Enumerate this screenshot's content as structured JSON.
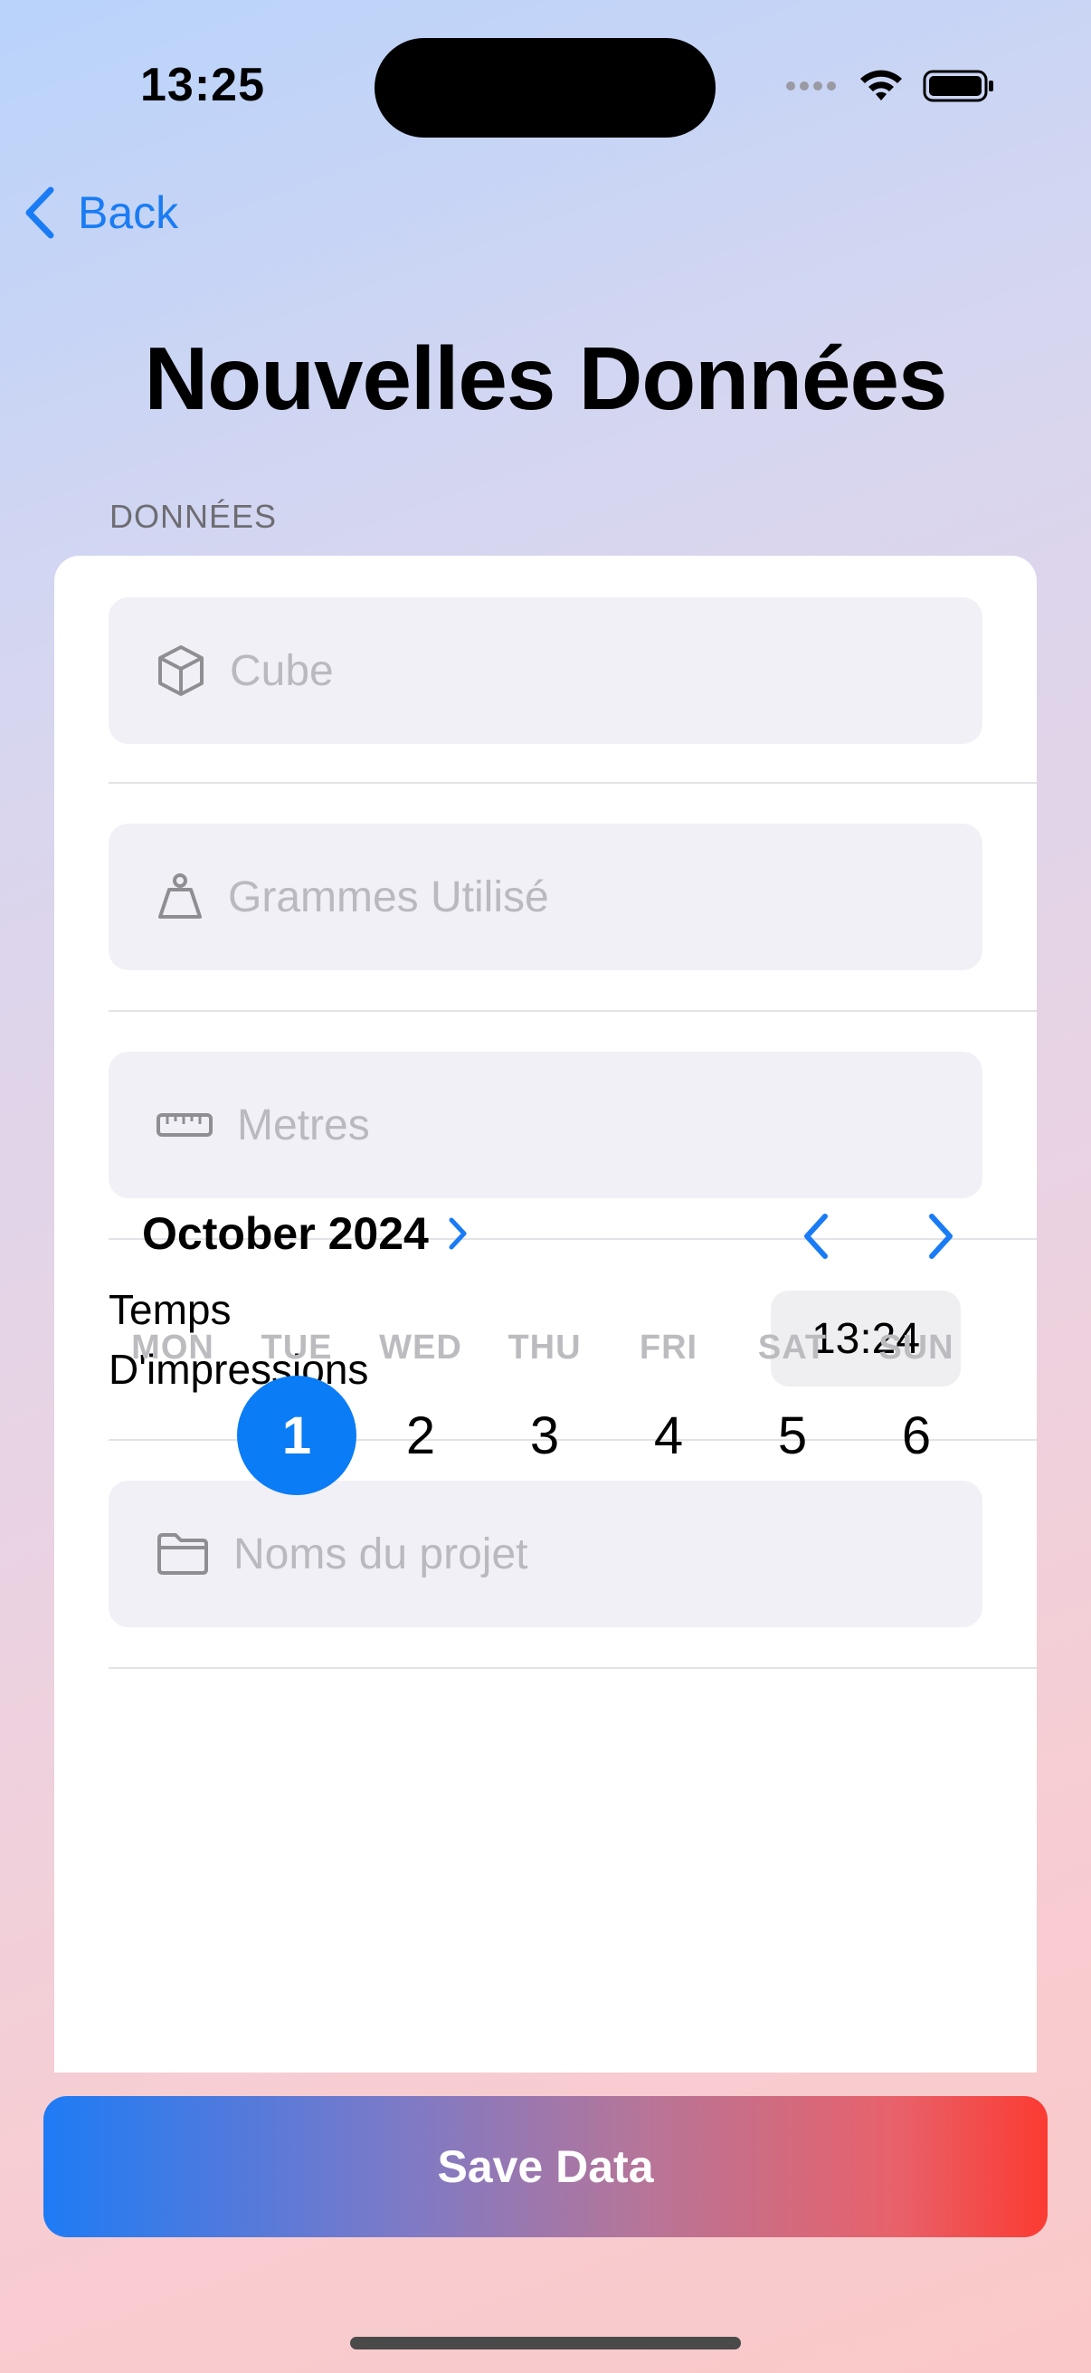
{
  "status_bar": {
    "time": "13:25"
  },
  "nav": {
    "back_label": "Back"
  },
  "page": {
    "title": "Nouvelles Données"
  },
  "form": {
    "section_header": "DONNÉES",
    "cube_placeholder": "Cube",
    "grams_placeholder": "Grammes Utilisé",
    "meters_placeholder": "Metres",
    "print_time_label_line1": "Temps",
    "print_time_label_line2": "D'impressions",
    "print_time_value": "13:24",
    "project_placeholder": "Noms du projet"
  },
  "calendar": {
    "month_label": "October 2024",
    "weekdays": [
      "MON",
      "TUE",
      "WED",
      "THU",
      "FRI",
      "SAT",
      "SUN"
    ],
    "days": [
      "1",
      "2",
      "3",
      "4",
      "5",
      "6"
    ],
    "selected_day": "1"
  },
  "actions": {
    "save_label": "Save Data"
  },
  "colors": {
    "accent": "#0a7cf5",
    "gradient_start": "#1e7bf5",
    "gradient_end": "#fb3b32"
  },
  "icons": {
    "cube": "cube-icon",
    "grams": "scale-weight-icon",
    "meters": "ruler-icon",
    "project": "folder-icon",
    "back": "chevron-left-icon",
    "month_picker": "chevron-right-icon"
  }
}
